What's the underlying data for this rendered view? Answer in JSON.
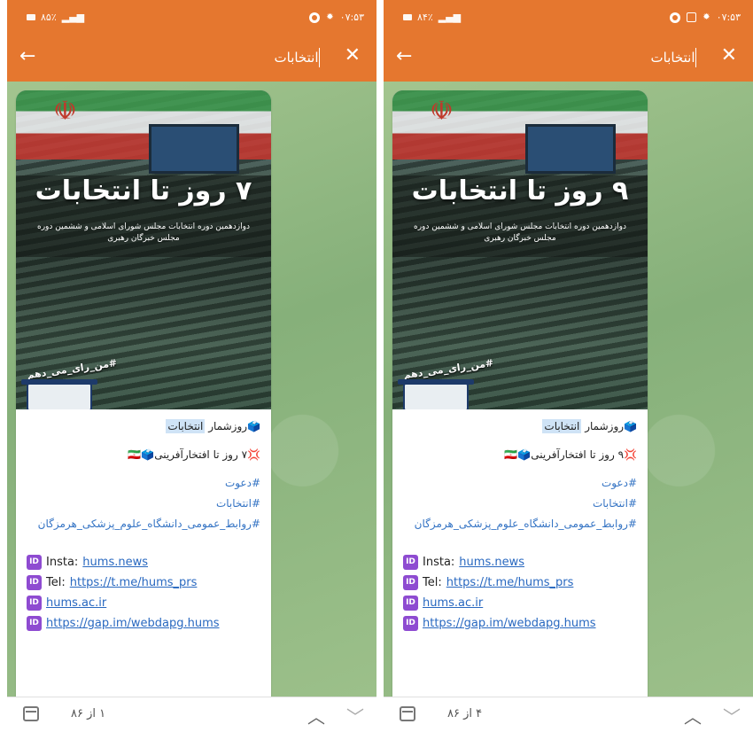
{
  "screens": [
    {
      "status_left": "۸۵٪ ",
      "status_time": "۰۷:۵۳",
      "search_text": "انتخابات",
      "poster_title": "۷ روز تا انتخابات",
      "poster_subtitle": "دوازدهمین دوره انتخابات مجلس شورای اسلامی و ششمین دوره مجلس خبرگان رهبری",
      "poster_hashtag": "#من_رای_می_دهم",
      "countdown_prefix": "روزشمار ",
      "countdown_highlight": "انتخابات",
      "days_line": "۷ روز تا افتخارآفرینی",
      "hashtags": [
        "#دعوت",
        "#انتخابات",
        "#روابط_عمومی_دانشگاه_علوم_پزشکی_هرمزگان"
      ],
      "links": [
        {
          "prefix": "Insta: ",
          "text": "hums.news"
        },
        {
          "prefix": "Tel: ",
          "text": "https://t.me/hums_prs"
        },
        {
          "prefix": "",
          "text": "hums.ac.ir"
        },
        {
          "prefix": "",
          "text": "https://gap.im/webdapg.hums"
        }
      ],
      "result_counter": "۱ از ۸۶"
    },
    {
      "status_left": "۸۴٪ ",
      "status_time": "۰۷:۵۳",
      "search_text": "انتخابات",
      "poster_title": "۹ روز تا انتخابات",
      "poster_subtitle": "دوازدهمین دوره انتخابات مجلس شورای اسلامی و ششمین دوره مجلس خبرگان رهبری",
      "poster_hashtag": "#من_رای_می_دهم",
      "countdown_prefix": "روزشمار ",
      "countdown_highlight": "انتخابات",
      "days_line": "۹ روز تا افتخارآفرینی",
      "hashtags": [
        "#دعوت",
        "#انتخابات",
        "#روابط_عمومی_دانشگاه_علوم_پزشکی_هرمزگان"
      ],
      "links": [
        {
          "prefix": "Insta: ",
          "text": "hums.news"
        },
        {
          "prefix": "Tel: ",
          "text": "https://t.me/hums_prs"
        },
        {
          "prefix": "",
          "text": "hums.ac.ir"
        },
        {
          "prefix": "",
          "text": "https://gap.im/webdapg.hums"
        }
      ],
      "result_counter": "۴ از ۸۶"
    }
  ],
  "icons": {
    "back": "arrow-left",
    "close": "x",
    "scroll_down": "chevron-down",
    "calendar": "calendar-search",
    "badge": "ID"
  },
  "colors": {
    "appbar": "#e5772f",
    "link": "#2868c0",
    "highlight": "#cfe3f6",
    "badge": "#8e4bd1"
  }
}
